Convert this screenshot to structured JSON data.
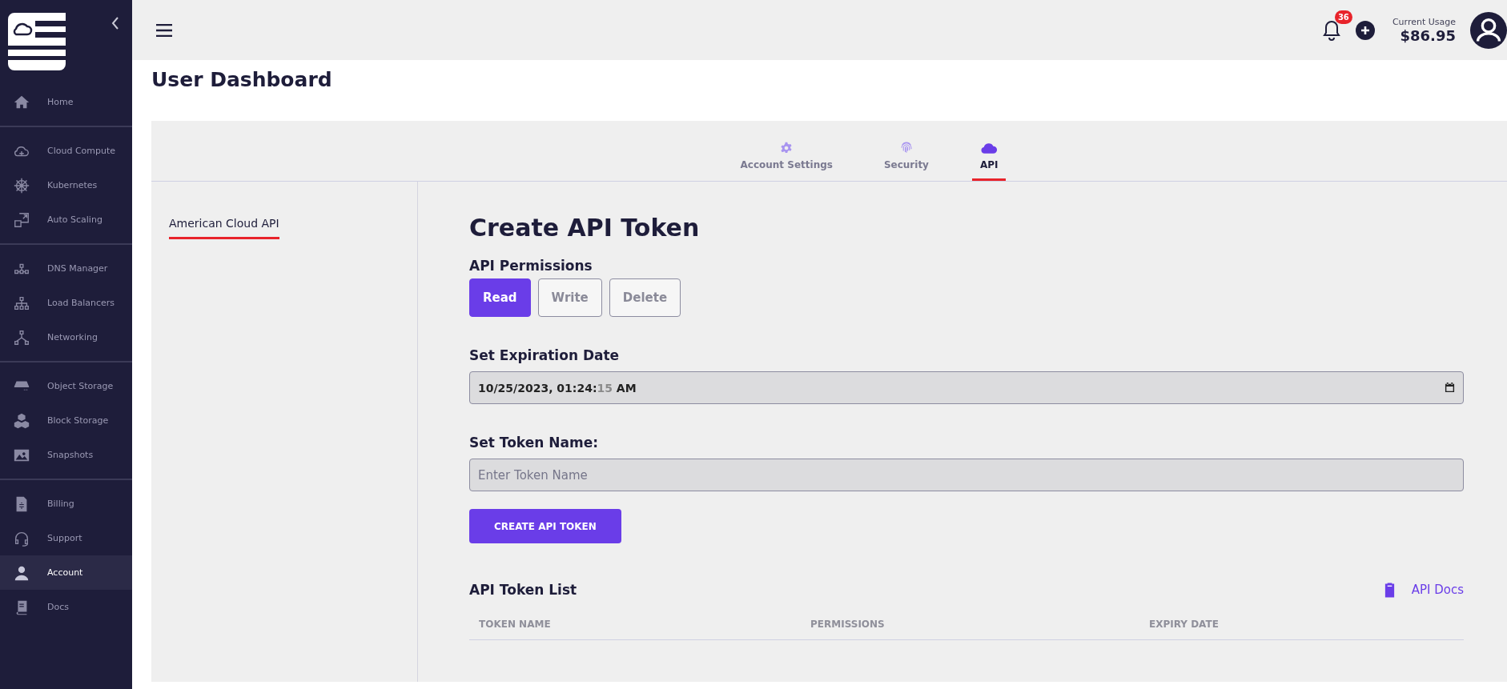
{
  "sidebar": {
    "groups": [
      {
        "items": [
          {
            "label": "Home",
            "selected": false
          }
        ]
      },
      {
        "items": [
          {
            "label": "Cloud Compute",
            "selected": false
          },
          {
            "label": "Kubernetes",
            "selected": false
          },
          {
            "label": "Auto Scaling",
            "selected": false
          }
        ]
      },
      {
        "items": [
          {
            "label": "DNS Manager",
            "selected": false
          },
          {
            "label": "Load Balancers",
            "selected": false
          },
          {
            "label": "Networking",
            "selected": false
          }
        ]
      },
      {
        "items": [
          {
            "label": "Object Storage",
            "selected": false
          },
          {
            "label": "Block Storage",
            "selected": false
          },
          {
            "label": "Snapshots",
            "selected": false
          }
        ]
      },
      {
        "items": [
          {
            "label": "Billing",
            "selected": false
          },
          {
            "label": "Support",
            "selected": false
          },
          {
            "label": "Account",
            "selected": true
          },
          {
            "label": "Docs",
            "selected": false
          }
        ]
      }
    ]
  },
  "header": {
    "notification_count": "36",
    "usage_label": "Current Usage",
    "usage_amount": "$86.95"
  },
  "page_title": "User Dashboard",
  "tabs": [
    {
      "label": "Account Settings",
      "selected": false
    },
    {
      "label": "Security",
      "selected": false
    },
    {
      "label": "API",
      "selected": true
    }
  ],
  "side_menu": [
    {
      "label": "American Cloud API",
      "selected": true
    }
  ],
  "form": {
    "title": "Create API Token",
    "permissions_label": "API Permissions",
    "permissions": [
      {
        "label": "Read",
        "selected": true
      },
      {
        "label": "Write",
        "selected": false
      },
      {
        "label": "Delete",
        "selected": false
      }
    ],
    "expiration_label": "Set Expiration Date",
    "expiration_value": [
      {
        "text": "10/25/2023, 01:24:",
        "dim": false
      },
      {
        "text": "15",
        "dim": true
      },
      {
        "text": " AM",
        "dim": false
      }
    ],
    "token_name_label": "Set Token Name:",
    "token_name_placeholder": "Enter Token Name",
    "submit": "CREATE API TOKEN"
  },
  "token_list": {
    "title": "API Token List",
    "docs_link": "API Docs",
    "columns": [
      "TOKEN NAME",
      "PERMISSIONS",
      "EXPIRY DATE"
    ]
  }
}
